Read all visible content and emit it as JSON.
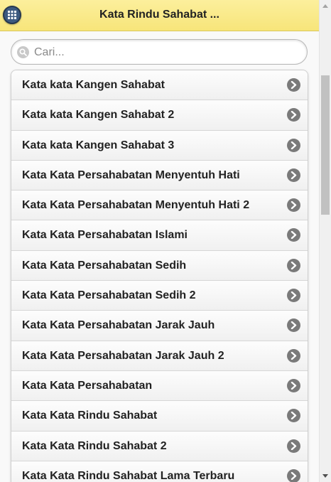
{
  "header": {
    "title": "Kata Rindu Sahabat ..."
  },
  "search": {
    "placeholder": "Cari..."
  },
  "list": {
    "items": [
      {
        "label": "Kata kata Kangen Sahabat"
      },
      {
        "label": "Kata kata Kangen Sahabat 2"
      },
      {
        "label": "Kata kata Kangen Sahabat 3"
      },
      {
        "label": "Kata Kata Persahabatan Menyentuh Hati"
      },
      {
        "label": "Kata Kata Persahabatan Menyentuh Hati 2"
      },
      {
        "label": "Kata Kata Persahabatan Islami"
      },
      {
        "label": "Kata Kata Persahabatan Sedih"
      },
      {
        "label": "Kata Kata Persahabatan Sedih 2"
      },
      {
        "label": "Kata Kata Persahabatan Jarak Jauh"
      },
      {
        "label": "Kata Kata Persahabatan Jarak Jauh 2"
      },
      {
        "label": "Kata Kata Persahabatan"
      },
      {
        "label": "Kata Kata Rindu Sahabat"
      },
      {
        "label": "Kata Kata Rindu Sahabat 2"
      },
      {
        "label": "Kata Kata Rindu Sahabat Lama Terbaru"
      }
    ]
  },
  "colors": {
    "header_bg": "#f7e57a",
    "menu_button": "#3d5a80",
    "chevron_icon": "#7a7a7a"
  },
  "icons": {
    "menu": "grid-icon",
    "search": "search-icon",
    "item_action": "chevron-right-icon"
  }
}
